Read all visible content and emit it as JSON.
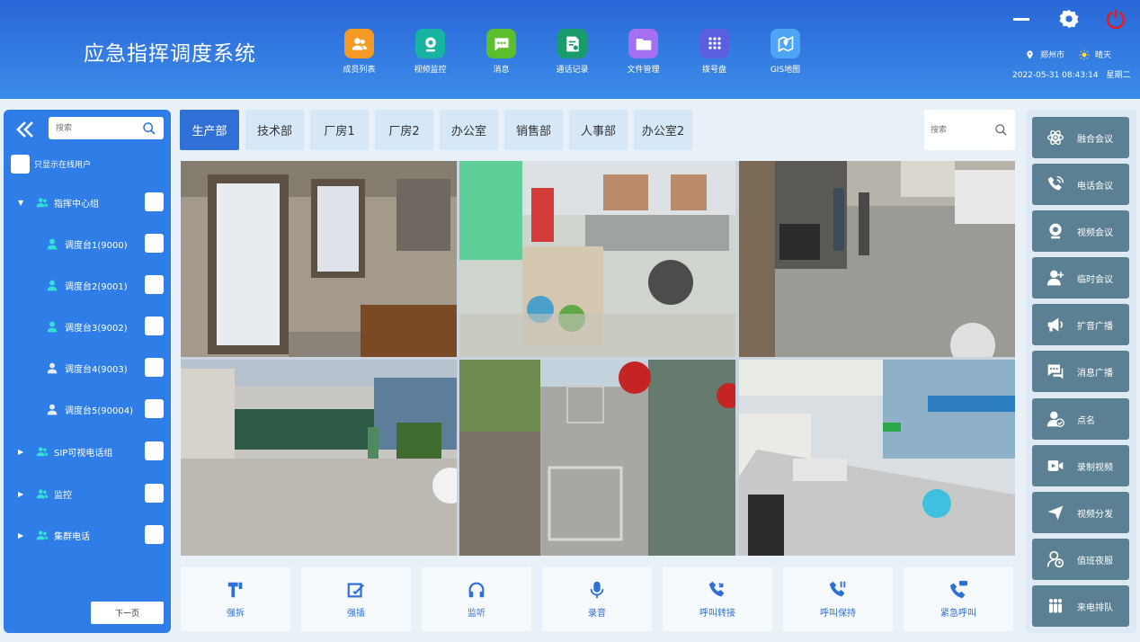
{
  "app": {
    "title": "应急指挥调度系统"
  },
  "nav": [
    {
      "label": "成员列表",
      "icon": "members-icon",
      "color": "#f59a23"
    },
    {
      "label": "视频监控",
      "icon": "camera-icon",
      "color": "#17b3a3"
    },
    {
      "label": "消息",
      "icon": "message-icon",
      "color": "#5bbf2d"
    },
    {
      "label": "通话记录",
      "icon": "call-record-icon",
      "color": "#199c6c"
    },
    {
      "label": "文件管理",
      "icon": "folder-icon",
      "color": "#a46ff0"
    },
    {
      "label": "拨号盘",
      "icon": "dialpad-icon",
      "color": "#5a5fe0"
    },
    {
      "label": "GIS地图",
      "icon": "map-pin-icon",
      "color": "#4ea5f5"
    }
  ],
  "status": {
    "city": "郑州市",
    "weather": "晴天",
    "datetime": "2022-05-31 08:43:14",
    "weekday": "星期二"
  },
  "left": {
    "search_placeholder": "搜索",
    "online_only": "只显示在线用户",
    "tree": [
      {
        "label": "指挥中心组",
        "type": "group",
        "expanded": true
      },
      {
        "label": "调度台1(9000)",
        "type": "user",
        "online": true
      },
      {
        "label": "调度台2(9001)",
        "type": "user",
        "online": true
      },
      {
        "label": "调度台3(9002)",
        "type": "user",
        "online": true
      },
      {
        "label": "调度台4(9003)",
        "type": "user",
        "online": false
      },
      {
        "label": "调度台5(90004)",
        "type": "user",
        "online": false
      },
      {
        "label": "SIP可视电话组",
        "type": "group",
        "expanded": false
      },
      {
        "label": "监控",
        "type": "group",
        "expanded": false
      },
      {
        "label": "集群电话",
        "type": "group",
        "expanded": false
      }
    ],
    "next_label": "下一页"
  },
  "tabs": [
    "生产部",
    "技术部",
    "厂房1",
    "厂房2",
    "办公室",
    "销售部",
    "人事部",
    "办公室2"
  ],
  "active_tab": 0,
  "main_search_placeholder": "搜索",
  "actions": [
    {
      "label": "强拆",
      "icon": "force-disconnect-icon"
    },
    {
      "label": "强插",
      "icon": "force-insert-icon"
    },
    {
      "label": "监听",
      "icon": "headphones-icon"
    },
    {
      "label": "录音",
      "icon": "microphone-icon"
    },
    {
      "label": "呼叫转接",
      "icon": "call-transfer-icon"
    },
    {
      "label": "呼叫保持",
      "icon": "call-hold-icon"
    },
    {
      "label": "紧急呼叫",
      "icon": "sos-call-icon"
    }
  ],
  "right": [
    {
      "label": "融合会议",
      "icon": "atom-icon"
    },
    {
      "label": "电话会议",
      "icon": "phone-icon"
    },
    {
      "label": "视频会议",
      "icon": "webcam-icon"
    },
    {
      "label": "临时会议",
      "icon": "user-add-icon"
    },
    {
      "label": "扩音广播",
      "icon": "megaphone-icon"
    },
    {
      "label": "消息广播",
      "icon": "chat-icon"
    },
    {
      "label": "点名",
      "icon": "user-check-icon"
    },
    {
      "label": "录制视频",
      "icon": "video-record-icon"
    },
    {
      "label": "视频分发",
      "icon": "send-icon"
    },
    {
      "label": "值班夜服",
      "icon": "duty-icon"
    },
    {
      "label": "来电排队",
      "icon": "queue-icon"
    }
  ],
  "colors": {
    "header": "#2a67d8",
    "panel": "#2f7ee8",
    "accent": "#2f6fd6",
    "right_button": "#5b7f93",
    "power": "#e02020"
  }
}
